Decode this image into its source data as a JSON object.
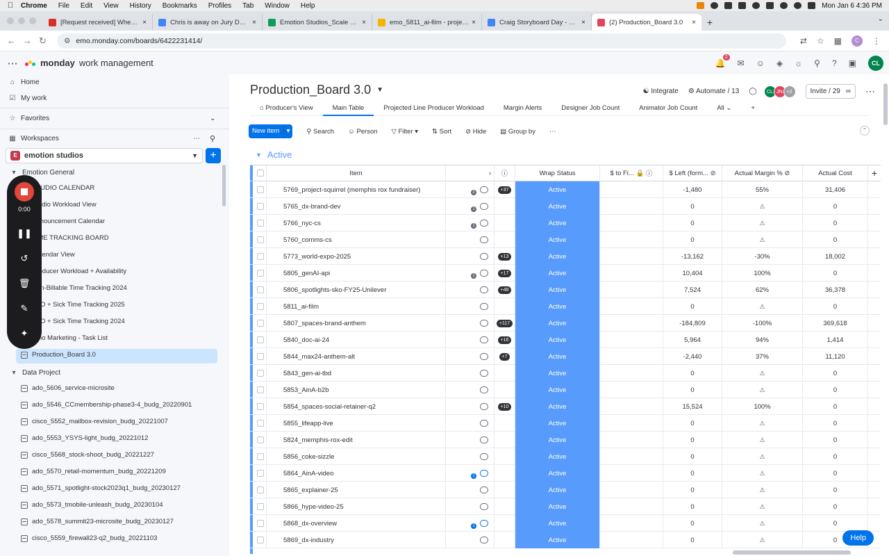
{
  "macos": {
    "menu": [
      "Chrome",
      "File",
      "Edit",
      "View",
      "History",
      "Bookmarks",
      "Profiles",
      "Tab",
      "Window",
      "Help"
    ],
    "clock": "Mon Jan 6  4:36 PM"
  },
  "browser": {
    "tabs": [
      {
        "title": "[Request received] When we",
        "color": "#d93025"
      },
      {
        "title": "Chris is away on Jury Duty (h",
        "color": "#4285f4"
      },
      {
        "title": "Emotion Studios_Scale Plan -",
        "color": "#0f9d58"
      },
      {
        "title": "emo_5811_ai-film - projects",
        "color": "#f4b400"
      },
      {
        "title": "Craig Storyboard Day - Shot l",
        "color": "#4285f4"
      },
      {
        "title": "(2) Production_Board 3.0",
        "color": "#e2445c"
      }
    ],
    "url": "emo.monday.com/boards/6422231414/",
    "profile": "C"
  },
  "monday": {
    "brand": "monday",
    "brand_suffix": "work management",
    "notifications": "2",
    "user_initials": "CL"
  },
  "sidebar": {
    "home": "Home",
    "mywork": "My work",
    "favorites": "Favorites",
    "workspaces": "Workspaces",
    "workspace_name": "emotion studios",
    "workspace_icon": "E",
    "folder1": "Emotion General",
    "boards": [
      "STUDIO CALENDAR",
      "Studio Workload View",
      "Announcement Calendar",
      "TIME TRACKING BOARD",
      "Calendar View",
      "Producer Workload + Availability",
      "Non-Billable Time Tracking 2024",
      "PTO + Sick Time Tracking 2025",
      "PTO + Sick Time Tracking 2024",
      "Emo Marketing - Task List",
      "Production_Board 3.0"
    ],
    "folder2": "Data Project",
    "data_boards": [
      "ado_5606_service-microsite",
      "ado_5546_CCmembership-phase3-4_budg_20220901",
      "cisco_5552_mailbox-revision_budg_20221007",
      "ado_5553_YSYS-light_budg_20221012",
      "cisco_5568_stock-shoot_budg_20221227",
      "ado_5570_retail-momentum_budg_20221209",
      "ado_5571_spotlight-stock2023q1_budg_20230127",
      "ado_5573_tmobile-unleash_budg_20230104",
      "ado_5578_summit23-microsite_budg_20230127",
      "cisco_5559_firewall23-q2_budg_20221103"
    ]
  },
  "recorder": {
    "time": "0:00"
  },
  "board": {
    "title": "Production_Board 3.0",
    "integrate": "Integrate",
    "automate": "Automate / 13",
    "avatars": [
      {
        "t": "CL",
        "c": "#00854d"
      },
      {
        "t": "JN",
        "c": "#e2445c"
      },
      {
        "t": "+2",
        "c": "#a0a0a8"
      }
    ],
    "invite": "Invite / 29",
    "views": [
      "Producer's View",
      "Main Table",
      "Projected Line Producer Workload",
      "Margin Alerts",
      "Designer Job Count",
      "Animator Job Count",
      "All"
    ],
    "toolbar": {
      "new_item": "New item",
      "search": "Search",
      "person": "Person",
      "filter": "Filter",
      "sort": "Sort",
      "hide": "Hide",
      "groupby": "Group by"
    },
    "group": "Active",
    "columns": {
      "item": "Item",
      "wrap": "Wrap Status",
      "fi": "$ to Fi...",
      "left": "$ Left (form...",
      "margin": "Actual Margin %",
      "cost": "Actual Cost"
    },
    "rows": [
      {
        "item": "5769_project-squirrel (memphis rox fundraiser)",
        "upd": "2",
        "sub": "+37",
        "status": "Active",
        "left": "-1,480",
        "margin": "55%",
        "cost": "31,406"
      },
      {
        "item": "5765_dx-brand-dev",
        "upd": "1",
        "sub": "",
        "status": "Active",
        "left": "0",
        "margin": "warn",
        "cost": "0"
      },
      {
        "item": "5766_nyc-cs",
        "upd": "1",
        "sub": "",
        "status": "Active",
        "left": "0",
        "margin": "warn",
        "cost": "0"
      },
      {
        "item": "5760_comms-cs",
        "upd": "",
        "sub": "",
        "status": "Active",
        "left": "0",
        "margin": "warn",
        "cost": "0"
      },
      {
        "item": "5773_world-expo-2025",
        "upd": "",
        "sub": "+13",
        "status": "Active",
        "left": "-13,162",
        "margin": "-30%",
        "cost": "18,002"
      },
      {
        "item": "5805_genAI-api",
        "upd": "1",
        "sub": "+17",
        "status": "Active",
        "left": "10,404",
        "margin": "100%",
        "cost": "0"
      },
      {
        "item": "5806_spotlights-sko-FY25-Unilever",
        "upd": "",
        "sub": "+48",
        "status": "Active",
        "left": "7,524",
        "margin": "62%",
        "cost": "36,378"
      },
      {
        "item": "5811_ai-film",
        "upd": "",
        "sub": "",
        "status": "Active",
        "left": "0",
        "margin": "warn",
        "cost": "0"
      },
      {
        "item": "5807_spaces-brand-anthem",
        "upd": "",
        "sub": "+117",
        "status": "Active",
        "left": "-184,809",
        "margin": "-100%",
        "cost": "369,618"
      },
      {
        "item": "5840_doc-ai-24",
        "upd": "",
        "sub": "+16",
        "status": "Active",
        "left": "5,964",
        "margin": "94%",
        "cost": "1,414"
      },
      {
        "item": "5844_max24-anthem-alt",
        "upd": "",
        "sub": "+7",
        "status": "Active",
        "left": "-2,440",
        "margin": "37%",
        "cost": "11,120"
      },
      {
        "item": "5843_gen-ai-tbd",
        "upd": "",
        "sub": "",
        "status": "Active",
        "left": "0",
        "margin": "warn",
        "cost": "0"
      },
      {
        "item": "5853_AinA-b2b",
        "upd": "",
        "sub": "",
        "status": "Active",
        "left": "0",
        "margin": "warn",
        "cost": "0"
      },
      {
        "item": "5854_spaces-social-retainer-q2",
        "upd": "",
        "sub": "+10",
        "status": "Active",
        "left": "15,524",
        "margin": "100%",
        "cost": "0"
      },
      {
        "item": "5855_lifeapp-live",
        "upd": "",
        "sub": "",
        "status": "Active",
        "left": "0",
        "margin": "warn",
        "cost": "0"
      },
      {
        "item": "5824_memphis-rox-edit",
        "upd": "",
        "sub": "",
        "status": "Active",
        "left": "0",
        "margin": "warn",
        "cost": "0"
      },
      {
        "item": "5856_coke-sizzle",
        "upd": "",
        "sub": "",
        "status": "Active",
        "left": "0",
        "margin": "warn",
        "cost": "0"
      },
      {
        "item": "5864_AinA-video",
        "upd": "1b",
        "sub": "",
        "status": "Active",
        "left": "0",
        "margin": "warn",
        "cost": "0"
      },
      {
        "item": "5865_explainer-25",
        "upd": "",
        "sub": "",
        "status": "Active",
        "left": "0",
        "margin": "warn",
        "cost": "0"
      },
      {
        "item": "5866_hype-video-25",
        "upd": "",
        "sub": "",
        "status": "Active",
        "left": "0",
        "margin": "warn",
        "cost": "0"
      },
      {
        "item": "5868_dx-overview",
        "upd": "1b",
        "sub": "",
        "status": "Active",
        "left": "0",
        "margin": "warn",
        "cost": "0"
      },
      {
        "item": "5869_dx-industry",
        "upd": "",
        "sub": "",
        "status": "Active",
        "left": "0",
        "margin": "warn",
        "cost": "0"
      }
    ],
    "help": "Help"
  }
}
